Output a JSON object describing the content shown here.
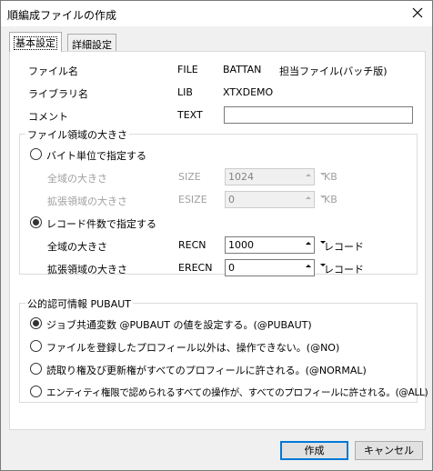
{
  "window": {
    "title": "順編成ファイルの作成"
  },
  "tabs": [
    {
      "label": "基本設定",
      "active": true
    },
    {
      "label": "詳細設定",
      "active": false
    }
  ],
  "basic": {
    "file_name": {
      "label": "ファイル名",
      "keyword": "FILE",
      "value": "BATTAN",
      "description": "担当ファイル(バッチ版)"
    },
    "library_name": {
      "label": "ライブラリ名",
      "keyword": "LIB",
      "value": "XTXDEMO"
    },
    "comment": {
      "label": "コメント",
      "keyword": "TEXT",
      "value": ""
    }
  },
  "file_size": {
    "group_title": "ファイル領域の大きさ",
    "byte_unit": {
      "label": "バイト単位で指定する",
      "selected": false,
      "total": {
        "label": "全域の大きさ",
        "keyword": "SIZE",
        "value": "1024",
        "unit": "KB"
      },
      "extension": {
        "label": "拡張領域の大きさ",
        "keyword": "ESIZE",
        "value": "0",
        "unit": "KB"
      }
    },
    "record_count": {
      "label": "レコード件数で指定する",
      "selected": true,
      "total": {
        "label": "全域の大きさ",
        "keyword": "RECN",
        "value": "1000",
        "unit": "レコード"
      },
      "extension": {
        "label": "拡張領域の大きさ",
        "keyword": "ERECN",
        "value": "0",
        "unit": "レコード"
      }
    }
  },
  "pubaut": {
    "group_title": "公的認可情報 PUBAUT",
    "options": [
      {
        "label": "ジョブ共通変数 @PUBAUT の値を設定する。(@PUBAUT)",
        "selected": true
      },
      {
        "label": "ファイルを登録したプロフィール以外は、操作できない。(@NO)",
        "selected": false
      },
      {
        "label": "読取り権及び更新権がすべてのプロフィールに許される。(@NORMAL)",
        "selected": false
      },
      {
        "label": "エンティティ権限で認められるすべての操作が、すべてのプロフィールに許される。(@ALL)",
        "selected": false
      }
    ]
  },
  "buttons": {
    "create": "作成",
    "cancel": "キャンセル"
  },
  "colors": {
    "accent": "#0078d7",
    "disabled_text": "#a0a0a0"
  }
}
